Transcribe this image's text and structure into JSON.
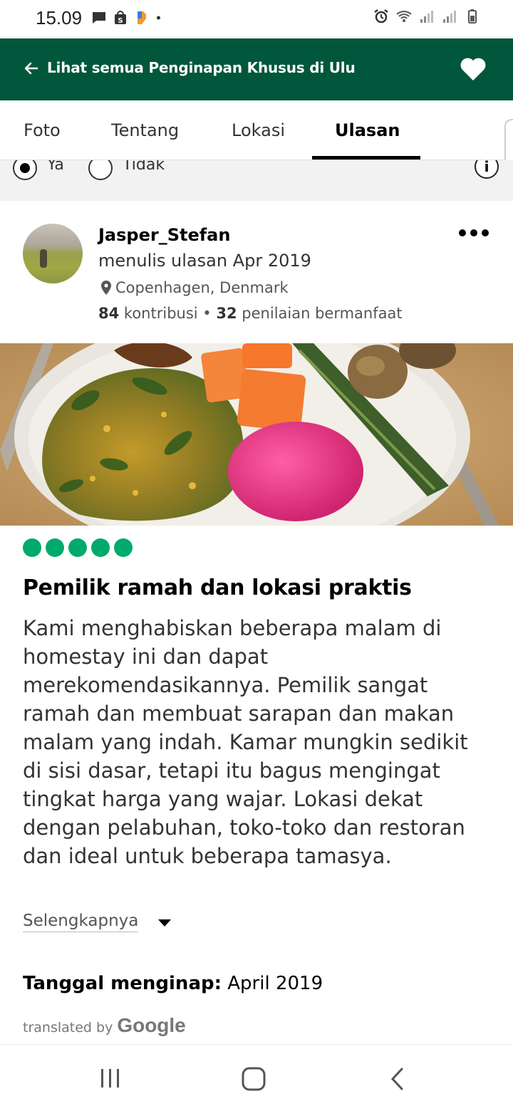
{
  "status_bar": {
    "time": "15.09",
    "notif_icons": [
      "chat-icon",
      "shopping-icon",
      "app-icon",
      "dot-icon"
    ],
    "right_icons": [
      "alarm-icon",
      "wifi-icon",
      "signal-icon",
      "signal-icon",
      "battery-icon"
    ]
  },
  "header": {
    "back_label": "Lihat semua Penginapan Khusus di Ulu",
    "favorite_icon": "heart-icon",
    "background": "#00573b"
  },
  "tabs": [
    {
      "label": "Foto"
    },
    {
      "label": "Tentang"
    },
    {
      "label": "Lokasi"
    },
    {
      "label": "Ulasan",
      "active": true
    }
  ],
  "filter": {
    "yes_label": "Ya",
    "no_label": "Tidak",
    "selected": "Ya"
  },
  "review": {
    "user_name": "Jasper_Stefan",
    "written": "menulis ulasan Apr 2019",
    "location": "Copenhagen, Denmark",
    "contrib_count": "84",
    "contrib_label": "kontribusi",
    "separator": "•",
    "helpful_count": "32",
    "helpful_label": "penilaian bermanfaat",
    "rating": 5,
    "rating_color": "#00aa6c",
    "title": "Pemilik ramah dan lokasi praktis",
    "body": "Kami menghabiskan beberapa malam di homestay ini dan dapat merekomendasikannya. Pemilik sangat ramah dan membuat sarapan dan makan malam yang indah. Kamar mungkin sedikit di sisi dasar, tetapi itu bagus mengingat tingkat harga yang wajar. Lokasi dekat dengan pelabuhan, toko-toko dan restoran dan ideal untuk beberapa tamasya.",
    "more_label": "Selengkapnya",
    "stay_label": "Tanggal menginap:",
    "stay_value": "April 2019",
    "translated_label": "translated by",
    "translated_brand": "Google"
  }
}
